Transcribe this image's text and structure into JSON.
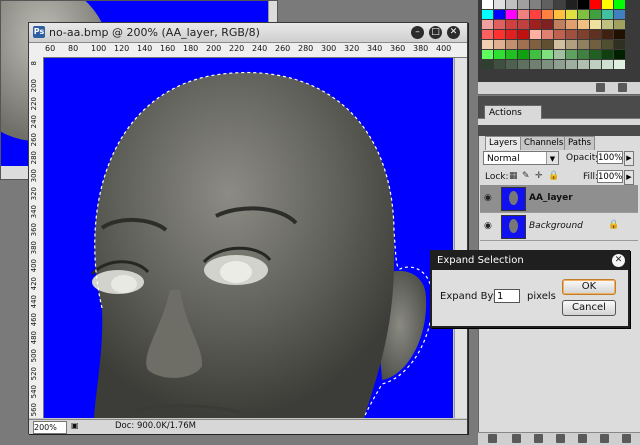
{
  "document": {
    "title": "no-aa.bmp @ 200% (AA_layer, RGB/8)",
    "ruler_top_ticks": [
      "60",
      "80",
      "100",
      "120",
      "140",
      "160",
      "180",
      "200",
      "220",
      "240",
      "260",
      "280",
      "300",
      "320",
      "340",
      "360",
      "380",
      "400"
    ],
    "ruler_left_ticks": [
      "8",
      "200",
      "220",
      "240",
      "260",
      "280",
      "300",
      "320",
      "340",
      "360",
      "380",
      "400",
      "420",
      "440",
      "460",
      "480",
      "500",
      "520",
      "540",
      "560"
    ],
    "zoom": "200%",
    "doc_info": "Doc: 900.0K/1.76M"
  },
  "panels": {
    "actions_tab": "Actions",
    "layers_tabs": [
      "Layers",
      "Channels",
      "Paths"
    ],
    "blend_mode": "Normal",
    "opacity_label": "Opacity:",
    "opacity_value": "100%",
    "lock_label": "Lock:",
    "fill_label": "Fill:",
    "fill_value": "100%",
    "layers": [
      {
        "name": "AA_layer",
        "selected": true,
        "locked": false
      },
      {
        "name": "Background",
        "selected": false,
        "locked": true
      }
    ]
  },
  "dialog": {
    "title": "Expand Selection",
    "expand_label": "Expand By:",
    "expand_value": "1",
    "unit_label": "pixels",
    "ok_label": "OK",
    "cancel_label": "Cancel"
  },
  "colors": {
    "canvas_background": "#0000ff",
    "dialog_titlebar": "#1f1f1f",
    "ok_button_highlight": "#c07d2a"
  },
  "swatches": [
    "#ffffff",
    "#e0e0e0",
    "#c0c0c0",
    "#a0a0a0",
    "#808080",
    "#606060",
    "#404040",
    "#202020",
    "#000000",
    "#ff0000",
    "#ffff00",
    "#00ff00",
    "#00ffff",
    "#0000ff",
    "#ff00ff",
    "#f08080",
    "#ff4040",
    "#ff8040",
    "#ffc040",
    "#e0e040",
    "#80c040",
    "#40a040",
    "#40c0a0",
    "#4080c0",
    "#f0a0a0",
    "#e06060",
    "#d04040",
    "#c04040",
    "#a02020",
    "#802020",
    "#c08060",
    "#e0a070",
    "#f0c080",
    "#f0e0a0",
    "#c0c080",
    "#a0a060",
    "#ff6060",
    "#ff3030",
    "#e02020",
    "#c01010",
    "#ffb0a0",
    "#e08070",
    "#c06050",
    "#a05040",
    "#804030",
    "#603020",
    "#402010",
    "#201000",
    "#f0d0b0",
    "#e0b090",
    "#c09070",
    "#a07050",
    "#806040",
    "#605030",
    "#d0c0a0",
    "#b0a080",
    "#908060",
    "#706040",
    "#505030",
    "#303020",
    "#60ff60",
    "#30e030",
    "#20c020",
    "#10a010",
    "#40c040",
    "#80e080",
    "#a0c0a0",
    "#60a060",
    "#408040",
    "#206020",
    "#104010",
    "#002000",
    "#304030",
    "#405040",
    "#506050",
    "#607060",
    "#708070",
    "#809080",
    "#90a090",
    "#a0b0a0",
    "#b0c0b0",
    "#c0d0c0",
    "#d0e0d0",
    "#e0f0e0"
  ]
}
